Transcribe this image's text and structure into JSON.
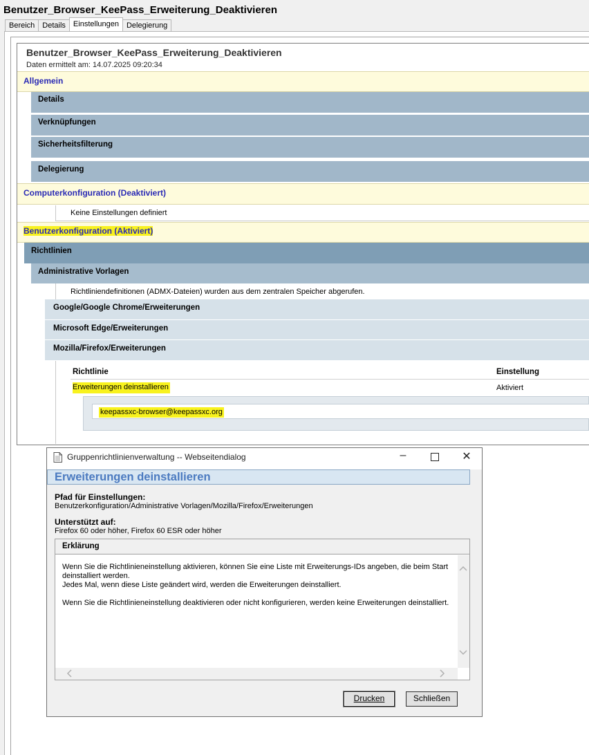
{
  "window": {
    "title": "Benutzer_Browser_KeePass_Erweiterung_Deaktivieren",
    "tabs": [
      "Bereich",
      "Details",
      "Einstellungen",
      "Delegierung"
    ],
    "active_tab": "Einstellungen"
  },
  "report": {
    "title": "Benutzer_Browser_KeePass_Erweiterung_Deaktivieren",
    "subtitle": "Daten ermittelt am: 14.07.2025 09:20:34",
    "allgemein": "Allgemein",
    "allgemein_sections": [
      "Details",
      "Verknüpfungen",
      "Sicherheitsfilterung",
      "Delegierung"
    ],
    "computer_config": "Computerkonfiguration (Deaktiviert)",
    "no_settings": "Keine Einstellungen definiert",
    "user_config": "Benutzerkonfiguration (Aktiviert)",
    "policies": "Richtlinien",
    "admin_templates": "Administrative Vorlagen",
    "admx_note": "Richtliniendefinitionen (ADMX-Dateien) wurden aus dem zentralen Speicher abgerufen.",
    "categories": [
      "Google/Google Chrome/Erweiterungen",
      "Microsoft Edge/Erweiterungen",
      "Mozilla/Firefox/Erweiterungen"
    ],
    "table": {
      "col_policy": "Richtlinie",
      "col_setting": "Einstellung",
      "row_policy": "Erweiterungen deinstallieren",
      "row_setting": "Aktiviert",
      "value": "keepassxc-browser@keepassxc.org"
    }
  },
  "dialog": {
    "title": "Gruppenrichtlinienverwaltung -- Webseitendialog",
    "heading": "Erweiterungen deinstallieren",
    "path_label": "Pfad für Einstellungen:",
    "path_value": "Benutzerkonfiguration/Administrative Vorlagen/Mozilla/Firefox/Erweiterungen",
    "supported_label": "Unterstützt auf:",
    "supported_value": "Firefox 60 oder höher, Firefox 60 ESR oder höher",
    "explanation_label": "Erklärung",
    "explanation_lines": [
      "Wenn Sie die Richtlinieneinstellung aktivieren, können Sie eine Liste mit Erweiterungs-IDs angeben, die beim Start",
      "deinstalliert werden.",
      "Jedes Mal, wenn diese Liste geändert wird, werden die Erweiterungen deinstalliert.",
      "",
      "Wenn Sie die Richtlinieneinstellung deaktivieren oder nicht konfigurieren, werden keine Erweiterungen deinstalliert."
    ],
    "print_button": "Drucken",
    "close_button": "Schließen",
    "highlight_color": "#f8f21e"
  }
}
